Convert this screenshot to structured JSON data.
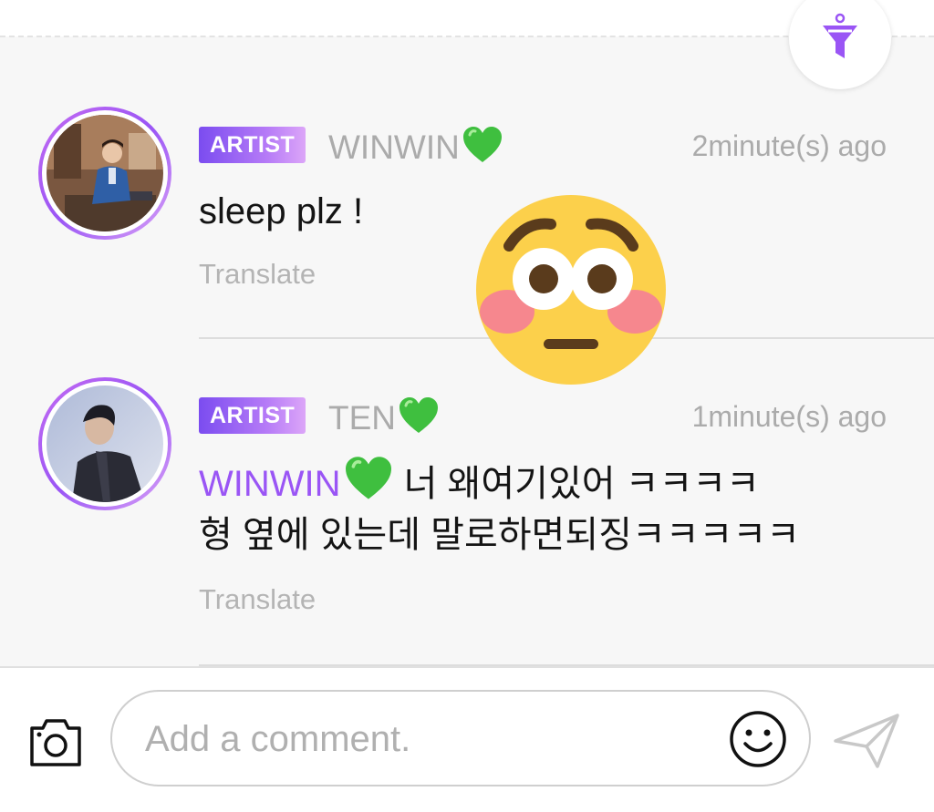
{
  "comments": [
    {
      "badge": "ARTIST",
      "author": "WINWIN",
      "time": "2minute(s) ago",
      "text": "sleep plz !",
      "translate": "Translate"
    },
    {
      "badge": "ARTIST",
      "author": "TEN",
      "time": "1minute(s) ago",
      "mention": "WINWIN",
      "text_line1": " 너 왜여기있어 ㅋㅋㅋㅋ",
      "text_line2": "형 옆에 있는데 말로하면되징ㅋㅋㅋㅋㅋ",
      "translate": "Translate"
    }
  ],
  "composer": {
    "placeholder": "Add a comment."
  },
  "icons": {
    "filter": "filter-funnel-icon",
    "camera": "camera-icon",
    "emoji": "smile-icon",
    "send": "send-icon",
    "heart": "green-heart-emoji",
    "sticker": "flushed-face-emoji"
  },
  "colors": {
    "accent": "#9a55f5",
    "badge_start": "#7b4cf0",
    "badge_end": "#dca6f8",
    "heart": "#3fbf3f",
    "muted_text": "#ababab"
  }
}
